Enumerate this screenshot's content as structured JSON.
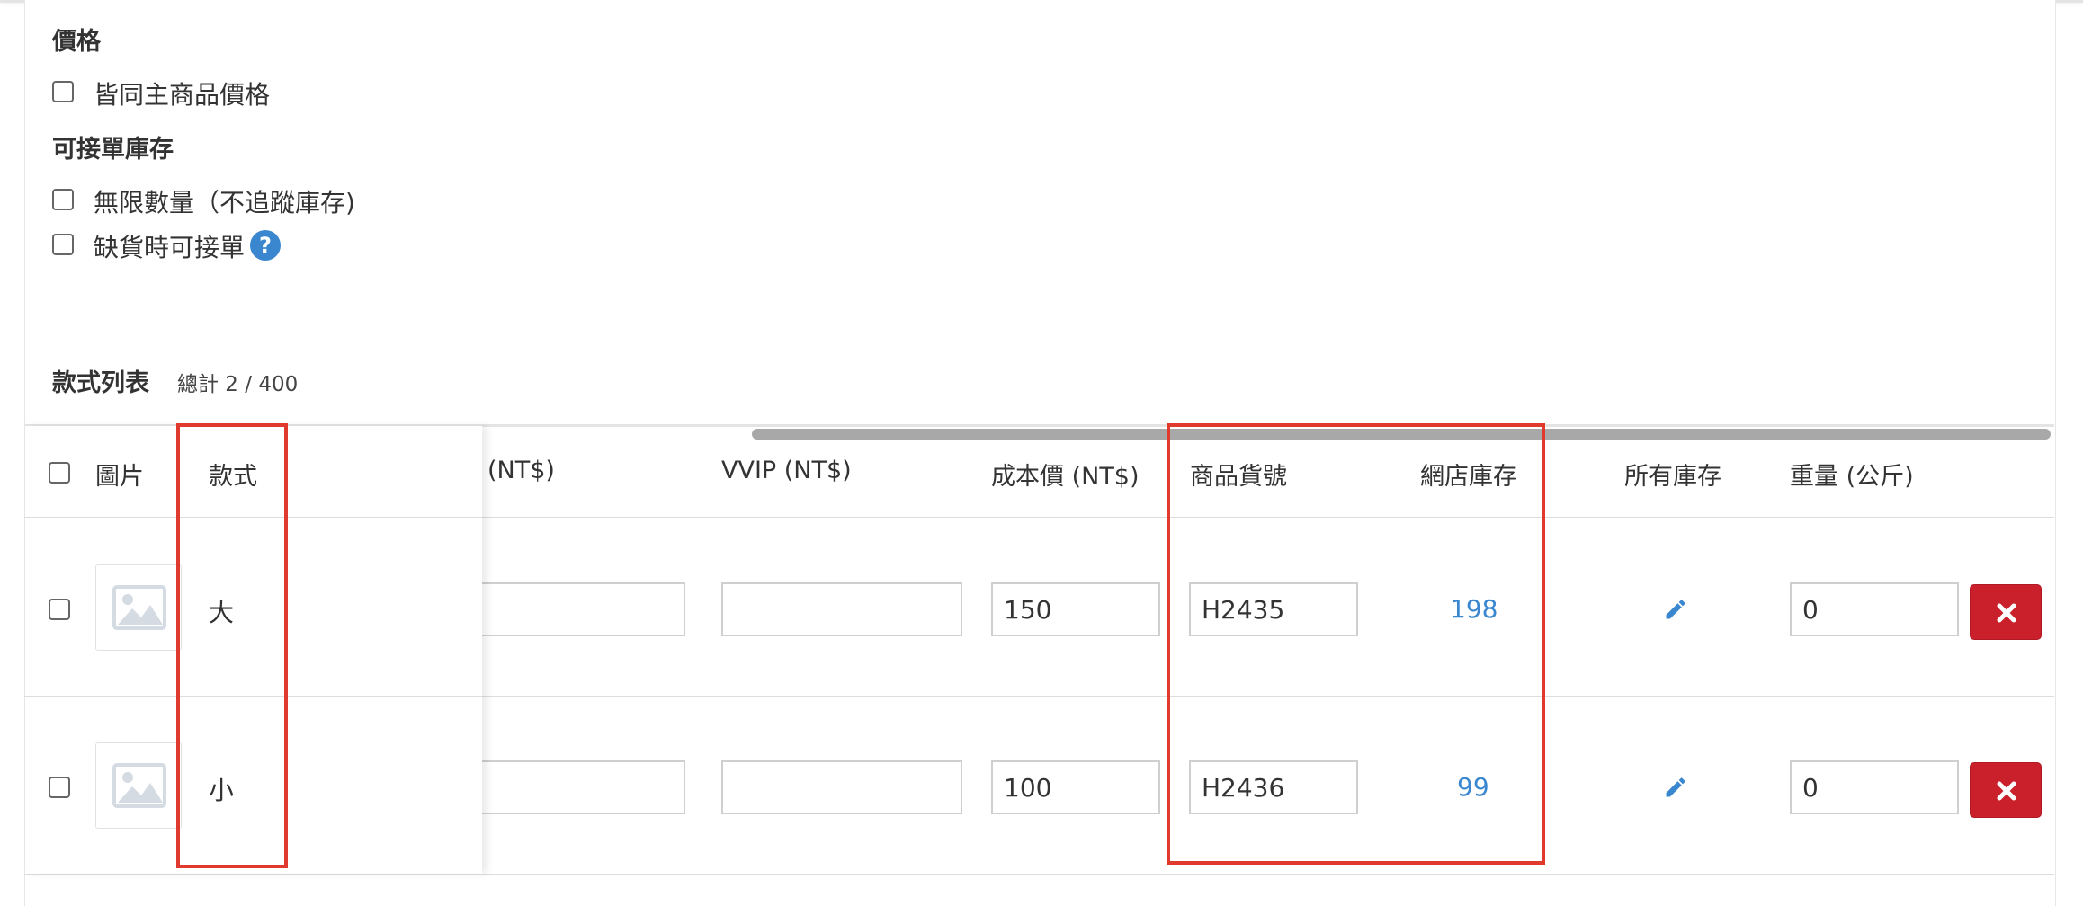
{
  "price_section": {
    "title": "價格",
    "same_as_main_label": "皆同主商品價格"
  },
  "stock_section": {
    "title": "可接單庫存",
    "unlimited_label": "無限數量（不追蹤庫存)",
    "backorder_label": "缺貨時可接單",
    "help_icon": "?"
  },
  "variant_list": {
    "title": "款式列表",
    "count": "總計 2 / 400"
  },
  "table": {
    "headers": {
      "image": "圖片",
      "variant": "款式",
      "price": "(NT$)",
      "vvip": "VVIP (NT$)",
      "cost": "成本價 (NT$)",
      "sku": "商品貨號",
      "online_stock": "網店庫存",
      "all_stock": "所有庫存",
      "weight": "重量 (公斤)"
    },
    "rows": [
      {
        "variant": "大",
        "price": "",
        "vvip": "",
        "cost": "150",
        "sku": "H2435",
        "online_stock": "198",
        "weight": "0"
      },
      {
        "variant": "小",
        "price": "",
        "vvip": "",
        "cost": "100",
        "sku": "H2436",
        "online_stock": "99",
        "weight": "0"
      }
    ]
  },
  "icons": {
    "image_placeholder": "image-placeholder-icon",
    "edit": "pencil-icon",
    "delete": "close-icon",
    "help": "question-circle-icon"
  },
  "colors": {
    "accent": "#3a87d0",
    "danger": "#c9202b",
    "highlight": "#e03a2f"
  }
}
